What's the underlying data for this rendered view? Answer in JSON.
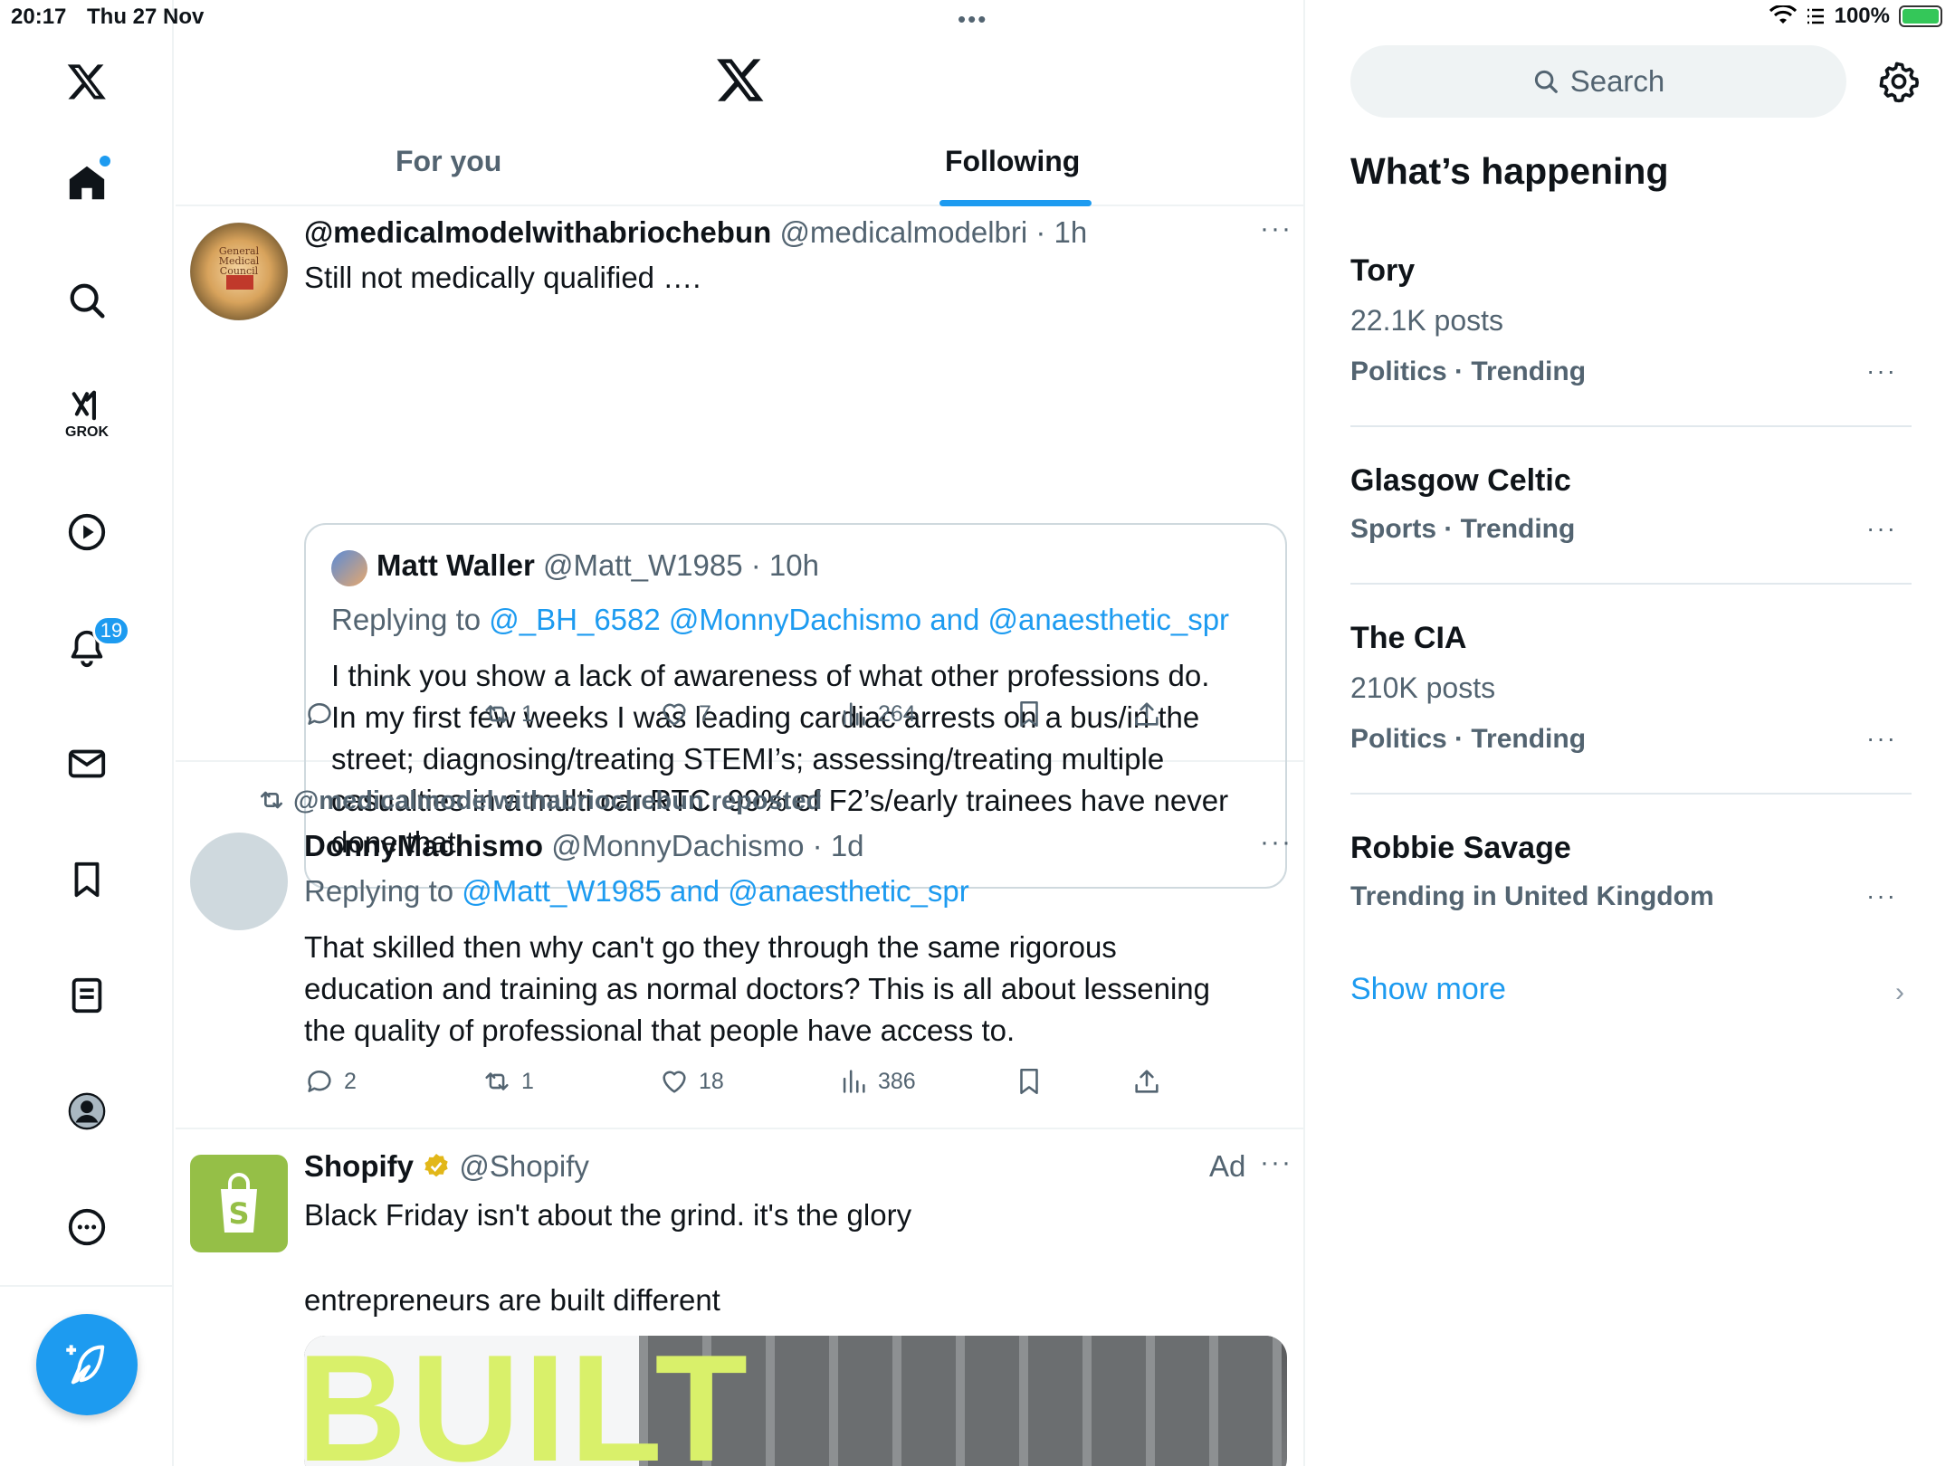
{
  "status_bar": {
    "time": "20:17",
    "date": "Thu 27 Nov",
    "battery": "100%"
  },
  "nav": {
    "grok_label": "GROK",
    "notifications_count": "19"
  },
  "header": {
    "tabs": [
      "For you",
      "Following"
    ],
    "active_tab": "Following"
  },
  "tweets": [
    {
      "name": "@medicalmodelwithabriochebun",
      "handle": "@medicalmodelbri",
      "time": "· 1h",
      "text": "Still not medically qualified ….",
      "quote": {
        "name": "Matt Waller",
        "handle": "@Matt_W1985",
        "time": "· 10h",
        "replying_prefix": "Replying to ",
        "replying_to": "@_BH_6582 @MonnyDachismo and @anaesthetic_spr",
        "lines": [
          "I think you show a lack of awareness of what other professions do.",
          "In my first few weeks I was leading cardiac arrests on a bus/in the",
          "street; diagnosing/treating STEMI’s; assessing/treating multiple",
          "casualties in a multi car RTC. 99% of F2’s/early trainees have never",
          "done that."
        ]
      },
      "stats": {
        "replies": "",
        "reposts": "1",
        "likes": "7",
        "views": "264"
      }
    },
    {
      "repost_label": "@medicalmodelwithabriochebun reposted",
      "name": "DonnyMachismo",
      "handle": "@MonnyDachismo",
      "time": "· 1d",
      "replying_prefix": "Replying to ",
      "replying_to": "@Matt_W1985 and @anaesthetic_spr",
      "lines": [
        "That skilled then why can't go they through the same rigorous",
        "education and training as normal doctors? This is all about lessening",
        "the quality of professional that people have access to."
      ],
      "stats": {
        "replies": "2",
        "reposts": "1",
        "likes": "18",
        "views": "386"
      }
    },
    {
      "name": "Shopify",
      "handle": "@Shopify",
      "ad_label": "Ad",
      "line1": "Black Friday isn't about the grind. it's the glory",
      "line2": "entrepreneurs are built different",
      "media_text": "BUILT"
    }
  ],
  "sidebar": {
    "search_placeholder": "Search",
    "title": "What’s happening",
    "trends": [
      {
        "name": "Tory",
        "count": "22.1K posts",
        "category": "Politics · Trending"
      },
      {
        "name": "Glasgow Celtic",
        "count": "",
        "category": "Sports · Trending"
      },
      {
        "name": "The CIA",
        "count": "210K posts",
        "category": "Politics · Trending"
      },
      {
        "name": "Robbie Savage",
        "count": "",
        "category": "Trending in United Kingdom"
      }
    ],
    "show_more": "Show more"
  },
  "colors": {
    "accent": "#1d9bf0",
    "text": "#0f1419",
    "muted": "#536471",
    "border": "#eff3f4",
    "shopify_green": "#95bf47",
    "verified_gold": "#e2b719"
  }
}
